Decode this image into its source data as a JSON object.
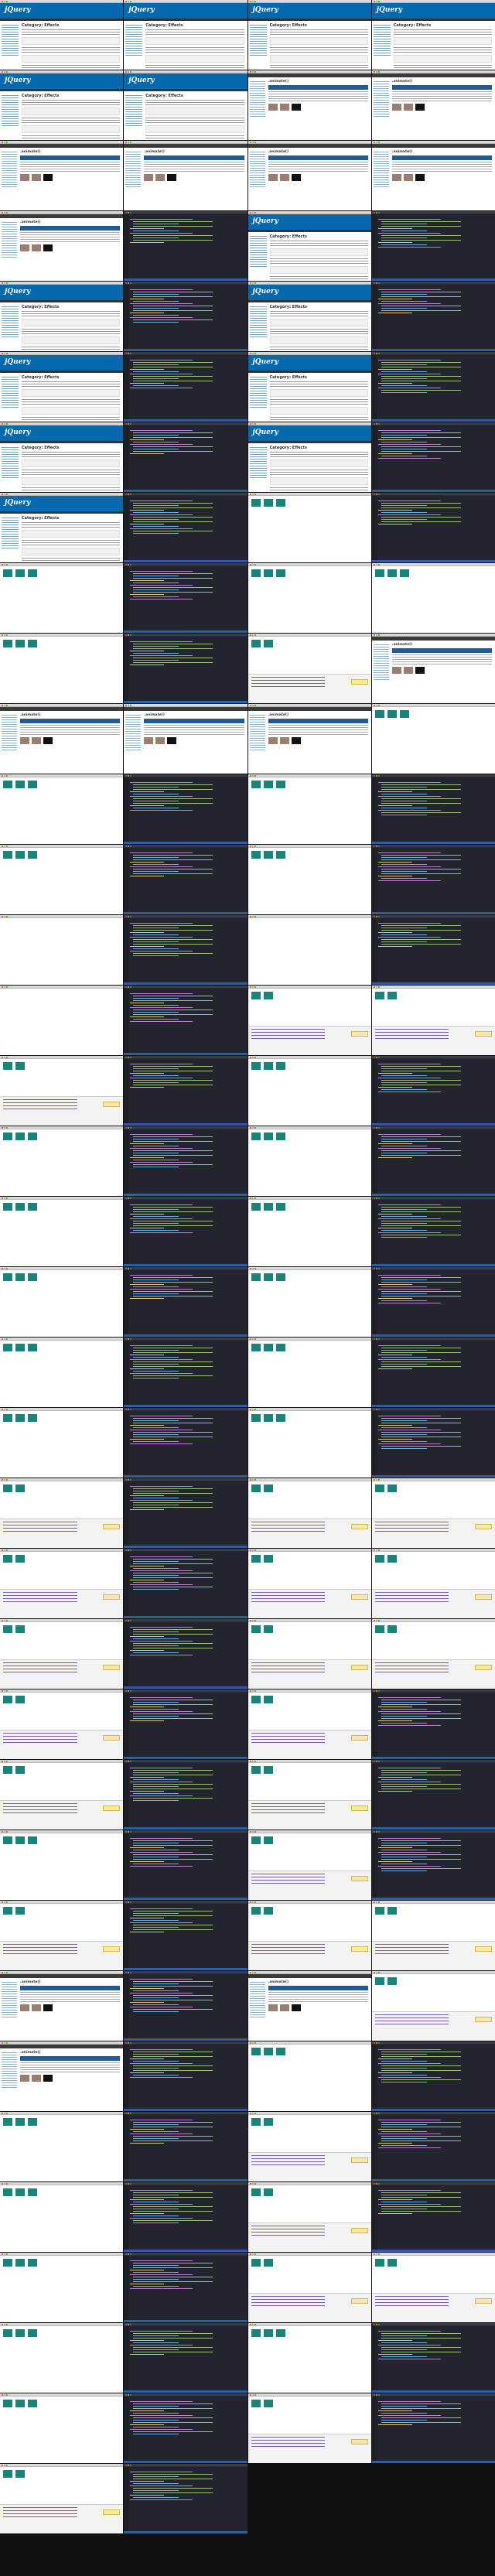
{
  "sheet": {
    "columns": 4,
    "site_logo": "jQuery",
    "category_title": "Category: Effects",
    "docs_title": ".animate()",
    "frames": [
      "jq",
      "jq",
      "jq",
      "jq",
      "jq",
      "jq",
      "docs",
      "docs",
      "docs",
      "docs",
      "docs",
      "docs",
      "docs",
      "editor",
      "jq",
      "editor",
      "jq",
      "editor",
      "jq",
      "editor",
      "jq",
      "editor",
      "jq",
      "editor",
      "jq",
      "editor",
      "jq",
      "editor",
      "jq",
      "editor",
      "preview",
      "editor",
      "preview",
      "editor",
      "preview",
      "preview",
      "preview",
      "editor",
      "devtools",
      "docs",
      "docs",
      "docs",
      "docs",
      "preview",
      "preview",
      "editor",
      "preview",
      "editor",
      "preview",
      "editor",
      "preview",
      "editor",
      "blank",
      "editor",
      "blank",
      "editor",
      "blank",
      "editor",
      "devtools",
      "devtools",
      "devtools",
      "editor",
      "preview",
      "editor",
      "preview",
      "editor",
      "preview",
      "editor",
      "preview",
      "editor",
      "preview",
      "editor",
      "preview",
      "editor",
      "preview",
      "editor",
      "preview",
      "editor",
      "preview",
      "editor",
      "preview",
      "editor",
      "preview",
      "editor",
      "devtools",
      "editor",
      "devtools",
      "devtools",
      "devtools",
      "editor",
      "devtools",
      "devtools",
      "devtools",
      "editor",
      "devtools",
      "devtools",
      "devtools",
      "editor",
      "devtools",
      "editor",
      "devtools",
      "editor",
      "devtools",
      "editor",
      "preview",
      "editor",
      "devtools",
      "editor",
      "devtools",
      "editor",
      "devtools",
      "devtools",
      "docs",
      "editor",
      "docs",
      "devtools",
      "docs",
      "editor",
      "preview",
      "editor",
      "preview",
      "editor",
      "devtools",
      "editor",
      "preview",
      "editor",
      "devtools",
      "editor",
      "preview",
      "editor",
      "devtools",
      "devtools",
      "preview",
      "editor",
      "preview",
      "editor",
      "preview",
      "editor",
      "devtools",
      "editor",
      "devtools",
      "editor",
      "empty",
      "empty"
    ]
  }
}
